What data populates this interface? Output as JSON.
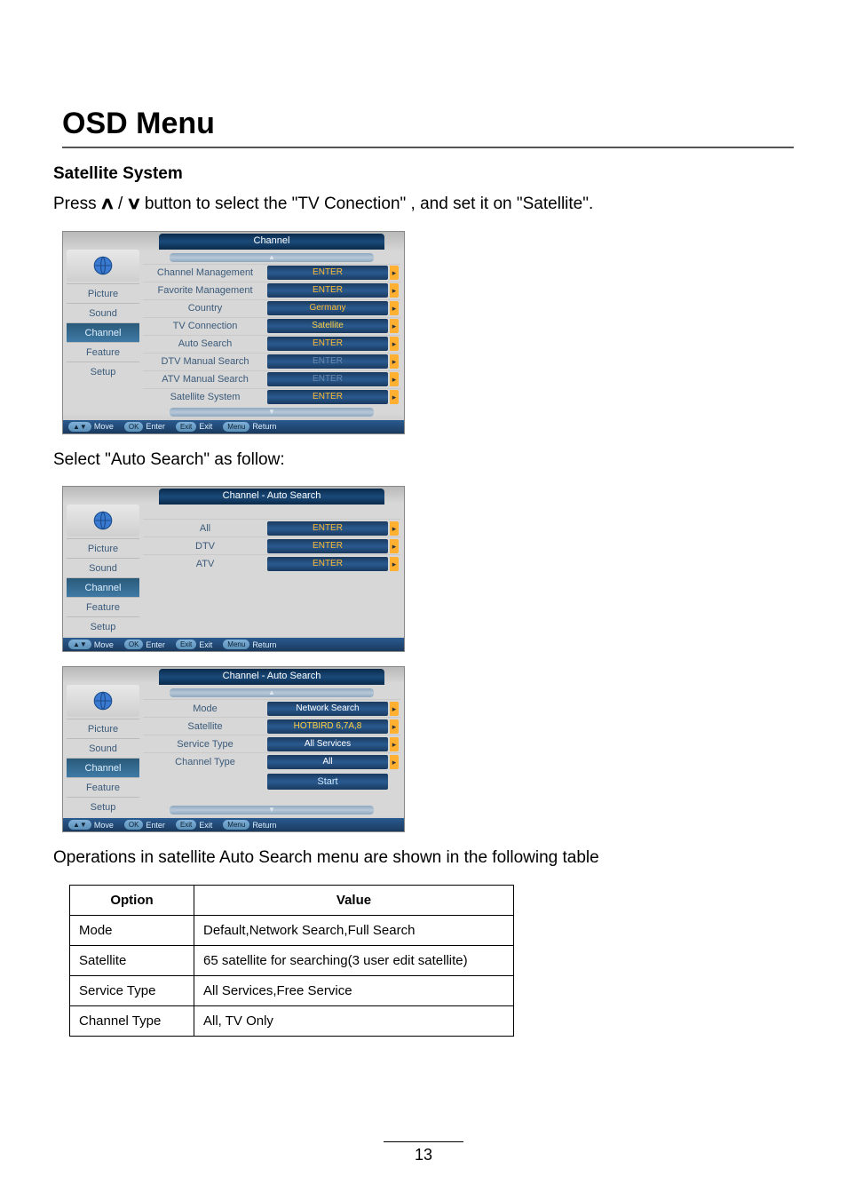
{
  "title": "OSD Menu",
  "section": "Satellite System",
  "instr_prefix": "Press ",
  "instr_mid": " button to select the \"TV Conection\" , and set it on \"Satellite\".",
  "instr2": "Select \"Auto Search\" as follow:",
  "instr3": "Operations in satellite Auto Search menu are shown in the following table",
  "osd": {
    "sidebar": [
      "Picture",
      "Sound",
      "Channel",
      "Feature",
      "Setup"
    ],
    "footer": {
      "move": "Move",
      "enter": "Enter",
      "exit": "Exit",
      "return": "Return",
      "ok": "OK",
      "exitkey": "Exit",
      "menu": "Menu",
      "av": "▲▼"
    }
  },
  "screen1": {
    "title": "Channel",
    "rows": [
      {
        "label": "Channel Management",
        "value": "ENTER",
        "cls": ""
      },
      {
        "label": "Favorite Management",
        "value": "ENTER",
        "cls": ""
      },
      {
        "label": "Country",
        "value": "Germany",
        "cls": ""
      },
      {
        "label": "TV Connection",
        "value": "Satellite",
        "cls": "hl"
      },
      {
        "label": "Auto Search",
        "value": "ENTER",
        "cls": ""
      },
      {
        "label": "DTV Manual Search",
        "value": "ENTER",
        "cls": "disabled"
      },
      {
        "label": "ATV Manual Search",
        "value": "ENTER",
        "cls": "disabled"
      },
      {
        "label": "Satellite System",
        "value": "ENTER",
        "cls": ""
      }
    ]
  },
  "screen2": {
    "title": "Channel - Auto Search",
    "rows": [
      {
        "label": "All",
        "value": "ENTER",
        "cls": ""
      },
      {
        "label": "DTV",
        "value": "ENTER",
        "cls": ""
      },
      {
        "label": "ATV",
        "value": "ENTER",
        "cls": ""
      }
    ]
  },
  "screen3": {
    "title": "Channel - Auto Search",
    "rows": [
      {
        "label": "Mode",
        "value": "Network Search",
        "cls": "white"
      },
      {
        "label": "Satellite",
        "value": "HOTBIRD 6,7A,8",
        "cls": "hl"
      },
      {
        "label": "Service Type",
        "value": "All Services",
        "cls": "white"
      },
      {
        "label": "Channel Type",
        "value": "All",
        "cls": "white"
      }
    ],
    "start": "Start"
  },
  "table": {
    "headers": [
      "Option",
      "Value"
    ],
    "rows": [
      {
        "option": "Mode",
        "value": "Default,Network Search,Full Search"
      },
      {
        "option": "Satellite",
        "value": "65 satellite for searching(3 user edit satellite)"
      },
      {
        "option": "Service Type",
        "value": "All Services,Free Service"
      },
      {
        "option": "Channel Type",
        "value": "All, TV Only"
      }
    ]
  },
  "page_number": "13"
}
